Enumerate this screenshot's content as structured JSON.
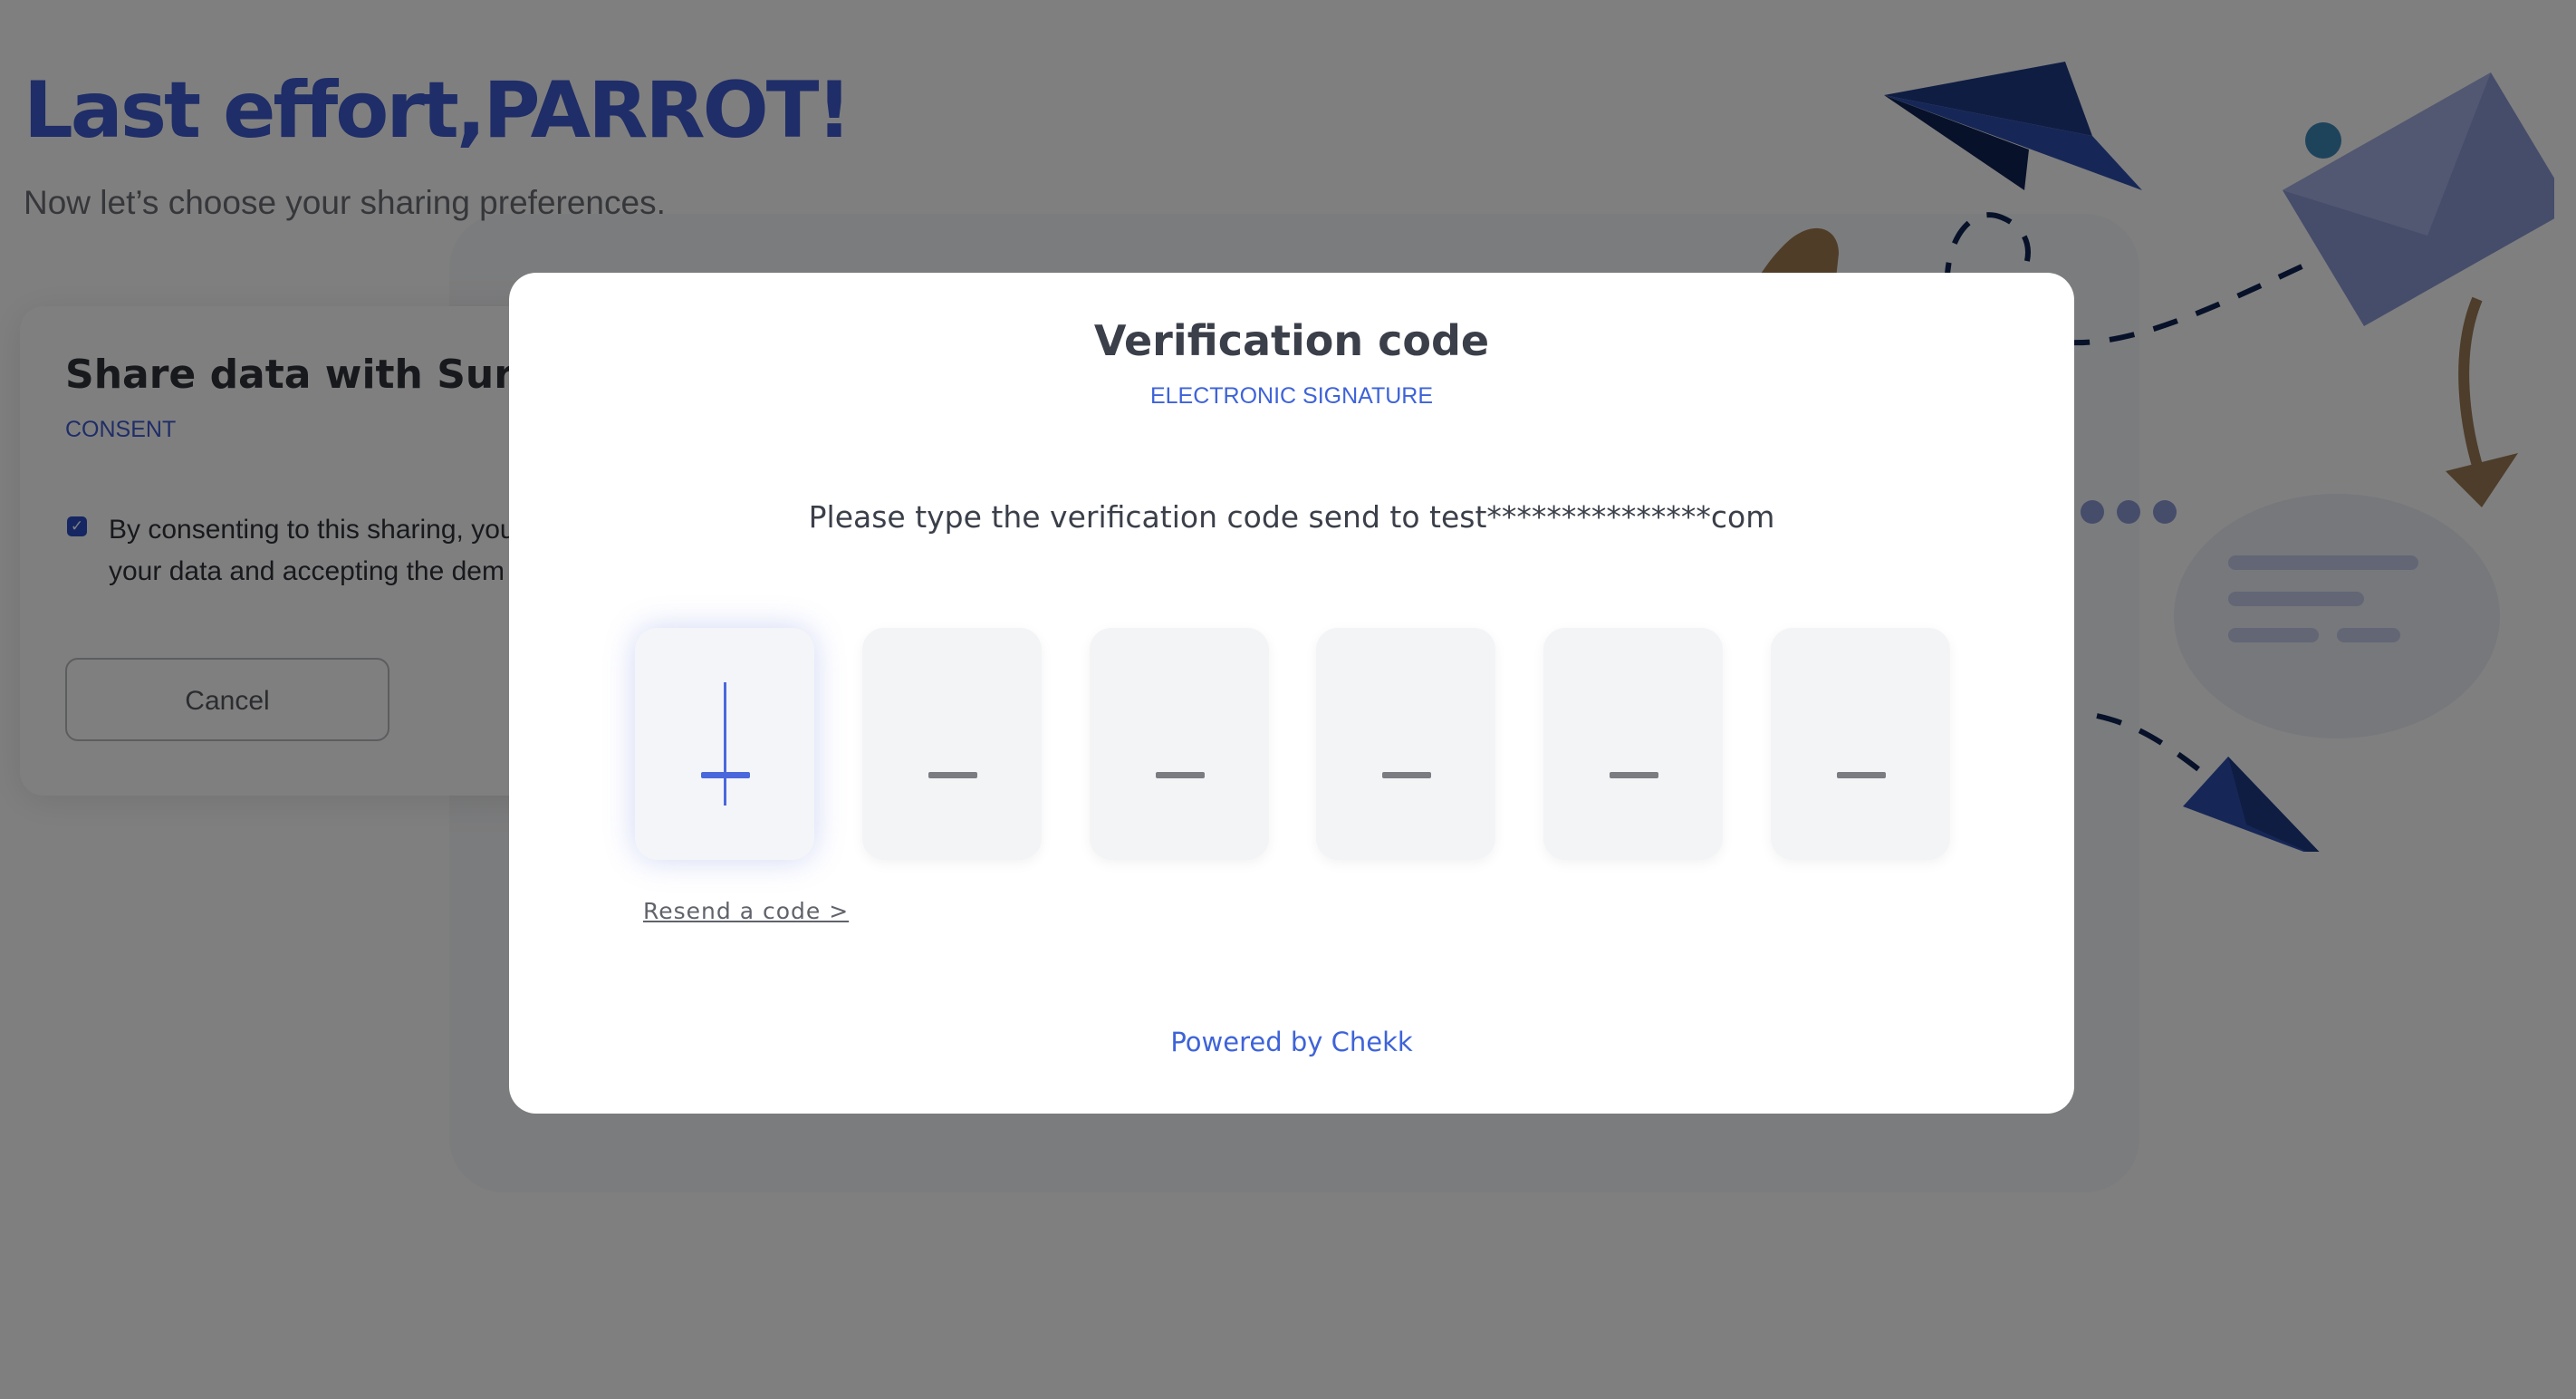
{
  "background": {
    "heading": "Last effort,PARROT!",
    "subheading": "Now let’s choose your sharing preferences.",
    "card": {
      "title": "Share data with Surfer l",
      "tag": "CONSENT",
      "consent_text_line1": "By consenting to this sharing, you",
      "consent_text_line2": "your data and accepting the dem",
      "checkbox_checked": true,
      "cancel_label": "Cancel"
    }
  },
  "modal": {
    "title": "Verification code",
    "tag": "ELECTRONIC SIGNATURE",
    "instruction": "Please type the verification code send to test***************com",
    "code_digits": [
      "",
      "",
      "",
      "",
      "",
      ""
    ],
    "active_digit": 1,
    "resend_label": "Resend a code >",
    "footer": "Powered by Chekk"
  },
  "colors": {
    "accent": "#3e63d9",
    "text": "#3b3f49",
    "overlay": "rgba(0,0,0,0.5)"
  }
}
